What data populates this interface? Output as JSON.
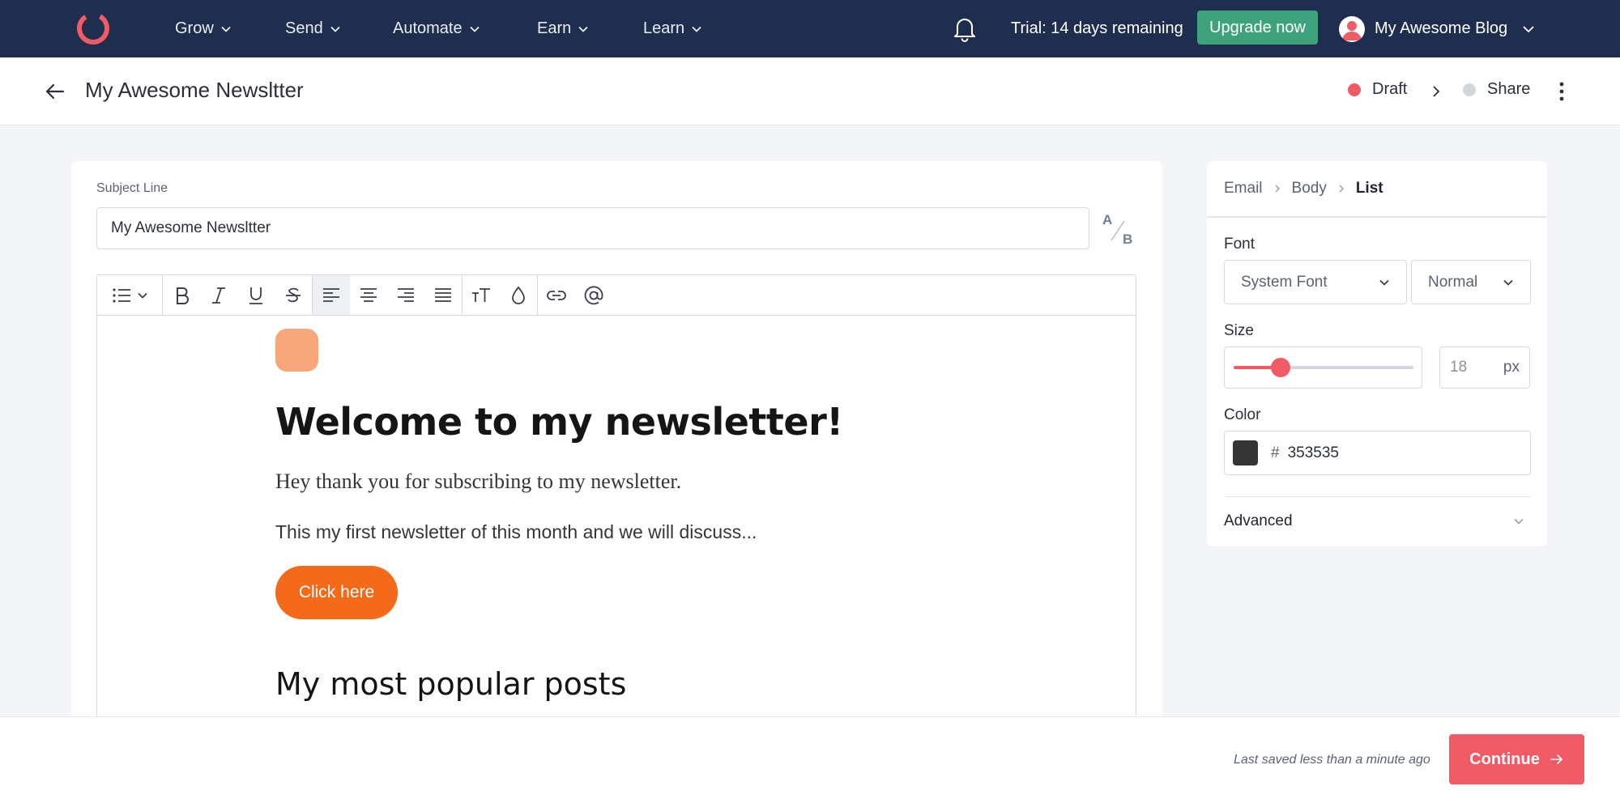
{
  "topnav": {
    "items": [
      "Grow",
      "Send",
      "Automate",
      "Earn",
      "Learn"
    ],
    "trial_text": "Trial: 14 days remaining",
    "upgrade_label": "Upgrade now",
    "account_name": "My Awesome Blog"
  },
  "header": {
    "title": "My Awesome Newsltter",
    "status_label": "Draft",
    "share_label": "Share"
  },
  "subject": {
    "label": "Subject Line",
    "value": "My Awesome Newsltter",
    "ab_label_a": "A",
    "ab_label_b": "B"
  },
  "editor": {
    "heading": "Welcome to my newsletter!",
    "paragraph1": "Hey thank you for subscribing to my newsletter.",
    "paragraph2": "This my first newsletter of this month and we will discuss...",
    "button_label": "Click here",
    "heading2": "My most popular posts"
  },
  "panel": {
    "breadcrumb": [
      "Email",
      "Body",
      "List"
    ],
    "font_label": "Font",
    "font_family": "System Font",
    "font_weight": "Normal",
    "size_label": "Size",
    "size_value": "18",
    "size_unit": "px",
    "size_slider_fraction": 0.26,
    "color_label": "Color",
    "color_hash": "#",
    "color_hex": "353535",
    "advanced_label": "Advanced"
  },
  "footer": {
    "saved_text": "Last saved less than a minute ago",
    "continue_label": "Continue"
  },
  "colors": {
    "nav_bg": "#1f2d4e",
    "upgrade": "#3ea37c",
    "accent": "#f05b66",
    "cta": "#f36a1a",
    "emoji_block": "#f8a77a",
    "text_color_swatch": "#353535",
    "share_dot": "#d3d6db"
  }
}
